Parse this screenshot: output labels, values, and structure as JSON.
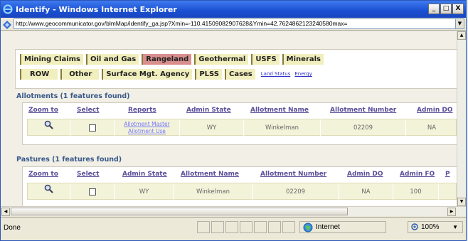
{
  "window": {
    "title": "Identify - Windows Internet Explorer",
    "caption_buttons": [
      "_",
      "□",
      "X"
    ]
  },
  "address": {
    "url": "http://www.geocommunicator.gov/blmMap/identify_ga.jsp?Xmin=-110.41509082907628&Ymin=42.7624862123240580max="
  },
  "tabs": {
    "row1": [
      "Mining Claims",
      "Oil and Gas",
      "Rangeland",
      "Geothermal",
      "USFS",
      "Minerals"
    ],
    "row2": [
      "ROW",
      "Other",
      "Surface Mgt. Agency",
      "PLSS",
      "Cases"
    ],
    "active": "Rangeland",
    "links": [
      "Land Status",
      "Energy"
    ]
  },
  "allotments": {
    "heading": "Allotments (1 features found)",
    "columns": [
      "Zoom to",
      "Select",
      "Reports",
      "Admin State",
      "Allotment Name",
      "Allotment Number",
      "Admin DO"
    ],
    "row": {
      "reports": [
        "Allotment Master",
        "Allotment Use"
      ],
      "admin_state": "WY",
      "allotment_name": "Winkelman",
      "allotment_number": "02209",
      "admin_do": "NA"
    }
  },
  "pastures": {
    "heading": "Pastures (1 features found)",
    "columns": [
      "Zoom to",
      "Select",
      "Admin State",
      "Allotment Name",
      "Allotment Number",
      "Admin DO",
      "Admin FO",
      "P"
    ],
    "row": {
      "admin_state": "WY",
      "allotment_name": "Winkelman",
      "allotment_number": "02209",
      "admin_do": "NA",
      "admin_fo": "100"
    }
  },
  "status": {
    "text": "Done",
    "zone": "Internet",
    "zoom": "100%"
  },
  "colors": {
    "titlebar": "#1a4fd1",
    "active_tab": "#d98e8e",
    "tab": "#f1efbd",
    "row_bg": "#f3f3da"
  }
}
